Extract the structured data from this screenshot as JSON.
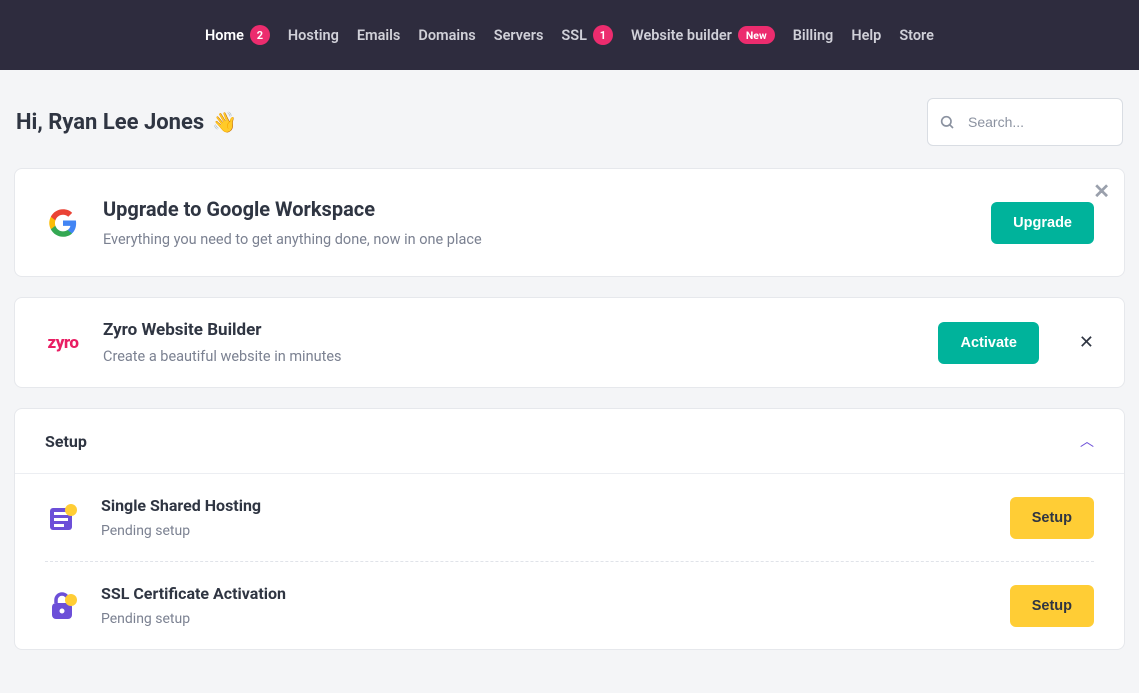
{
  "nav": {
    "items": [
      {
        "label": "Home",
        "badge": "2",
        "active": true
      },
      {
        "label": "Hosting"
      },
      {
        "label": "Emails"
      },
      {
        "label": "Domains"
      },
      {
        "label": "Servers"
      },
      {
        "label": "SSL",
        "badge": "1"
      },
      {
        "label": "Website builder",
        "new": "New"
      },
      {
        "label": "Billing"
      },
      {
        "label": "Help"
      },
      {
        "label": "Store"
      }
    ]
  },
  "greeting": "Hi, Ryan Lee Jones",
  "search": {
    "placeholder": "Search..."
  },
  "banner1": {
    "logo": "google-logo",
    "title": "Upgrade to Google Workspace",
    "subtitle": "Everything you need to get anything done, now in one place",
    "cta": "Upgrade"
  },
  "banner2": {
    "logo_text": "zyro",
    "title": "Zyro Website Builder",
    "subtitle": "Create a beautiful website in minutes",
    "cta": "Activate"
  },
  "setup": {
    "title": "Setup",
    "items": [
      {
        "icon": "hosting-icon",
        "title": "Single Shared Hosting",
        "subtitle": "Pending setup",
        "cta": "Setup"
      },
      {
        "icon": "ssl-lock-icon",
        "title": "SSL Certificate Activation",
        "subtitle": "Pending setup",
        "cta": "Setup"
      }
    ]
  }
}
